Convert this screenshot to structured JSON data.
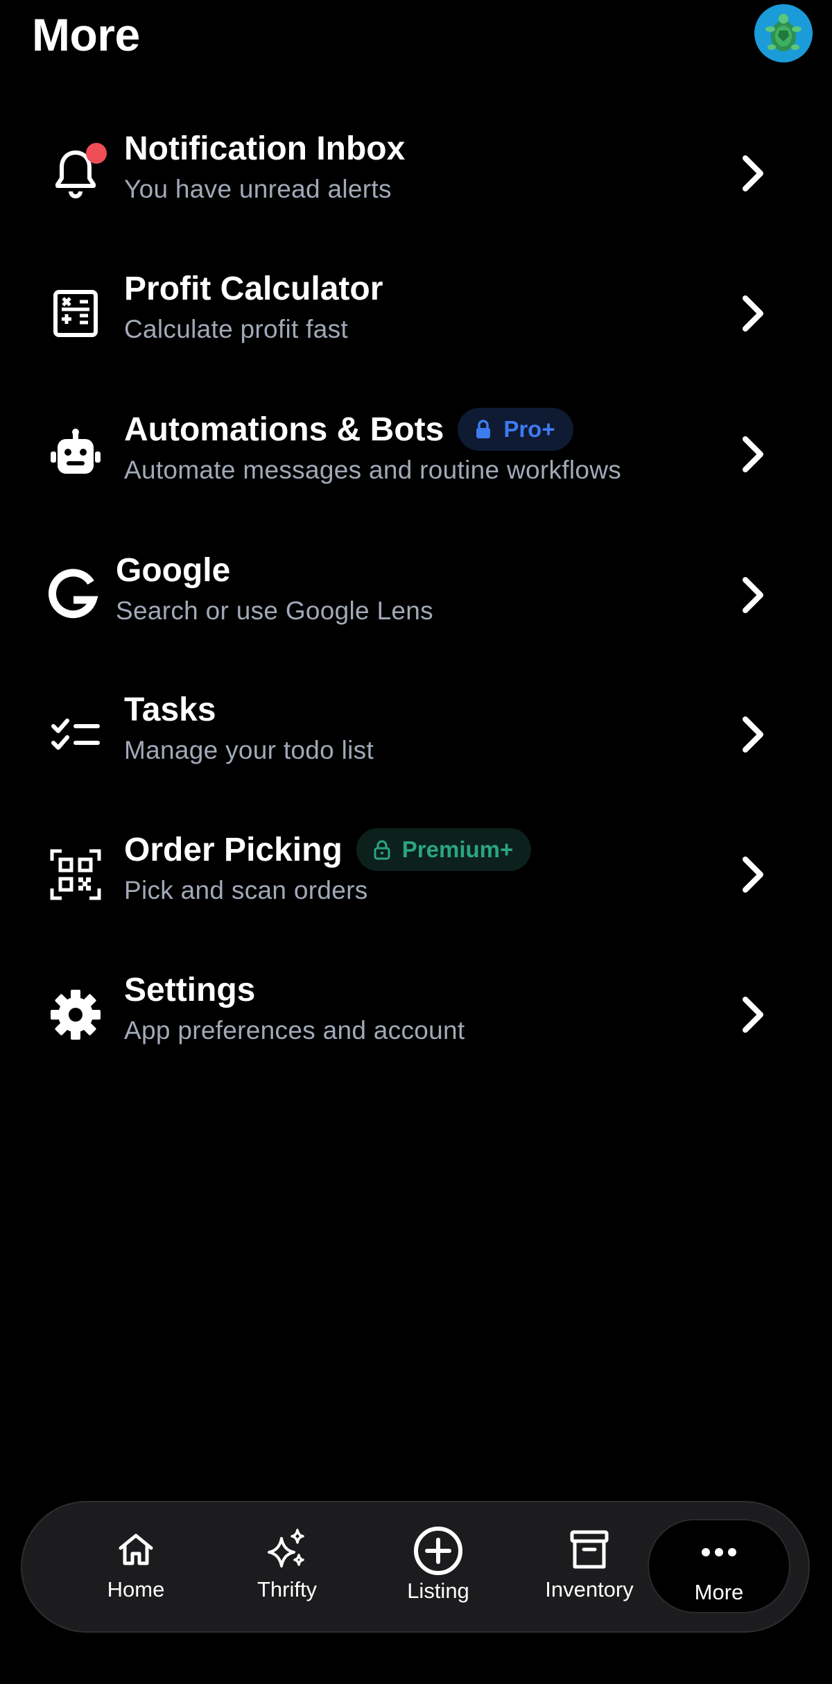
{
  "header": {
    "title": "More",
    "avatar_icon": "turtle-avatar-icon",
    "avatar_color": "#1b9bd8"
  },
  "menu": {
    "items": [
      {
        "id": "notifications",
        "icon": "bell-icon",
        "title": "Notification Inbox",
        "subtitle": "You have unread alerts",
        "has_unread_dot": true
      },
      {
        "id": "profit-calculator",
        "icon": "calculator-icon",
        "title": "Profit Calculator",
        "subtitle": "Calculate profit fast"
      },
      {
        "id": "automations",
        "icon": "robot-icon",
        "title": "Automations & Bots",
        "subtitle": "Automate messages and routine workflows",
        "badge": "Pro+",
        "badge_icon": "lock-icon"
      },
      {
        "id": "google",
        "icon": "google-g-icon",
        "title": "Google",
        "subtitle": "Search or use Google Lens"
      },
      {
        "id": "tasks",
        "icon": "checklist-icon",
        "title": "Tasks",
        "subtitle": "Manage your todo list"
      },
      {
        "id": "order-picking",
        "icon": "qr-scan-icon",
        "title": "Order Picking",
        "subtitle": "Pick and scan orders",
        "badge": "Premium+",
        "badge_icon": "lock-open-icon"
      },
      {
        "id": "settings",
        "icon": "gear-icon",
        "title": "Settings",
        "subtitle": "App preferences and account"
      }
    ]
  },
  "bottom_nav": {
    "items": [
      {
        "label": "Home",
        "icon": "home-icon"
      },
      {
        "label": "Thrifty",
        "icon": "sparkles-icon"
      },
      {
        "label": "Listing",
        "icon": "plus-circle-icon"
      },
      {
        "label": "Inventory",
        "icon": "archive-box-icon"
      },
      {
        "label": "More",
        "icon": "more-dots-icon",
        "active": true
      }
    ]
  },
  "colors": {
    "background": "#000000",
    "subtitle": "#a2a9b7",
    "notification_dot": "#ef4e57",
    "pro_badge_text": "#3d7bef",
    "pro_badge_bg": "#0f1a33",
    "premium_badge_text": "#2aa581",
    "premium_badge_bg": "#0c201c",
    "nav_bar": "#1c1c1e"
  }
}
